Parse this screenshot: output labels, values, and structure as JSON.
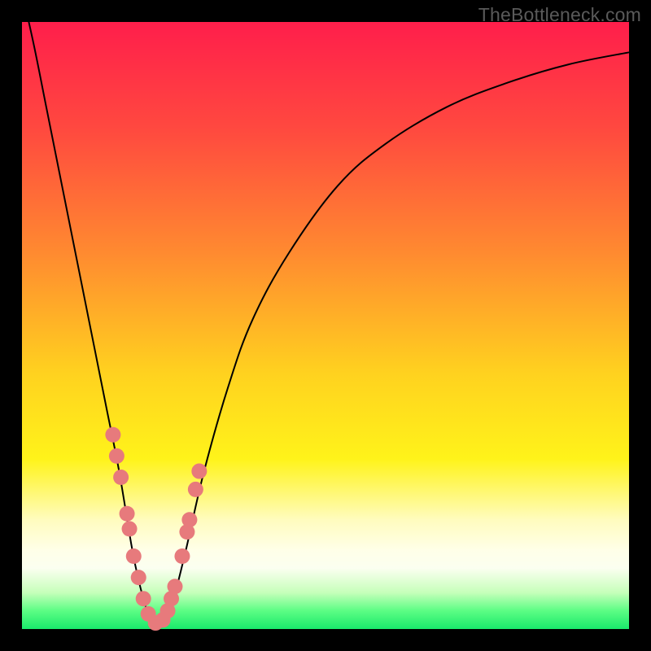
{
  "watermark": "TheBottleneck.com",
  "colors": {
    "frame": "#000000",
    "curve": "#000000",
    "marker": "#e77a7c",
    "gradient_stops": [
      {
        "pos": 0,
        "color": "#ff1e4b"
      },
      {
        "pos": 18,
        "color": "#ff4a3f"
      },
      {
        "pos": 38,
        "color": "#ff8a30"
      },
      {
        "pos": 58,
        "color": "#ffd21f"
      },
      {
        "pos": 72,
        "color": "#fff31a"
      },
      {
        "pos": 82,
        "color": "#fffcbe"
      },
      {
        "pos": 87,
        "color": "#ffffe8"
      },
      {
        "pos": 90,
        "color": "#fbfff0"
      },
      {
        "pos": 94,
        "color": "#c6ffba"
      },
      {
        "pos": 97,
        "color": "#5cfd84"
      },
      {
        "pos": 100,
        "color": "#19e96b"
      }
    ]
  },
  "chart_data": {
    "type": "line",
    "title": "",
    "xlabel": "",
    "ylabel": "",
    "xlim": [
      0,
      100
    ],
    "ylim": [
      0,
      100
    ],
    "series": [
      {
        "name": "bottleneck-curve",
        "x": [
          0,
          2,
          4,
          6,
          8,
          10,
          12,
          14,
          16,
          18,
          19,
          20,
          21,
          22,
          23,
          24,
          25,
          27,
          30,
          34,
          38,
          44,
          52,
          60,
          70,
          80,
          90,
          100
        ],
        "y": [
          105,
          96,
          86,
          76,
          66,
          56,
          46,
          36,
          26,
          14,
          9,
          5,
          2,
          1,
          1,
          2,
          5,
          13,
          26,
          40,
          51,
          62,
          73,
          80,
          86,
          90,
          93,
          95
        ]
      }
    ],
    "markers": {
      "name": "highlight-points",
      "x": [
        15.0,
        15.6,
        16.3,
        17.3,
        17.7,
        18.4,
        19.2,
        20.0,
        20.8,
        22.0,
        23.2,
        24.0,
        24.6,
        25.2,
        26.4,
        27.2,
        27.6,
        28.6,
        29.2
      ],
      "y": [
        32.0,
        28.5,
        25.0,
        19.0,
        16.5,
        12.0,
        8.5,
        5.0,
        2.5,
        1.0,
        1.5,
        3.0,
        5.0,
        7.0,
        12.0,
        16.0,
        18.0,
        23.0,
        26.0
      ]
    }
  }
}
